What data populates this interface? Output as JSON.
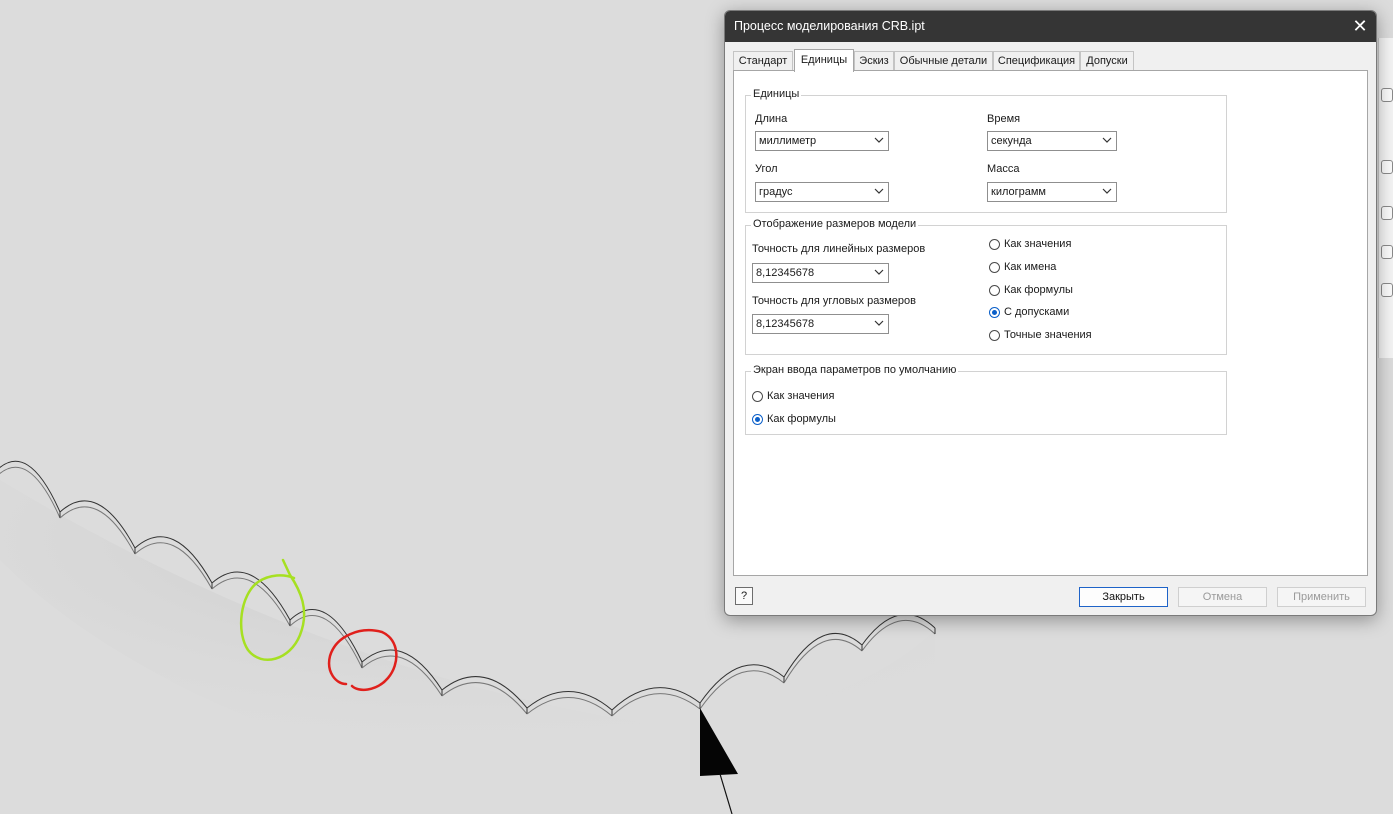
{
  "dialog": {
    "title": "Процесс моделирования CRB.ipt",
    "close_glyph": "✕",
    "tabs": [
      {
        "label": "Стандарт",
        "active": false
      },
      {
        "label": "Единицы",
        "active": true
      },
      {
        "label": "Эскиз",
        "active": false
      },
      {
        "label": "Обычные детали",
        "active": false
      },
      {
        "label": "Спецификация",
        "active": false
      },
      {
        "label": "Допуски",
        "active": false
      }
    ],
    "units": {
      "title": "Единицы",
      "length": {
        "label": "Длина",
        "value": "миллиметр"
      },
      "time": {
        "label": "Время",
        "value": "секунда"
      },
      "angle": {
        "label": "Угол",
        "value": "градус"
      },
      "mass": {
        "label": "Масса",
        "value": "килограмм"
      }
    },
    "dimension_display": {
      "title": "Отображение размеров модели",
      "linear_precision": {
        "label": "Точность для линейных размеров",
        "value": "8,12345678"
      },
      "angular_precision": {
        "label": "Точность для угловых размеров",
        "value": "8,12345678"
      },
      "options": [
        {
          "label": "Как значения",
          "selected": false
        },
        {
          "label": "Как имена",
          "selected": false
        },
        {
          "label": "Как формулы",
          "selected": false
        },
        {
          "label": "С допусками",
          "selected": true
        },
        {
          "label": "Точные значения",
          "selected": false
        }
      ]
    },
    "parameter_input": {
      "title": "Экран ввода параметров по умолчанию",
      "options": [
        {
          "label": "Как значения",
          "selected": false
        },
        {
          "label": "Как формулы",
          "selected": true
        }
      ]
    },
    "help_glyph": "?",
    "buttons": {
      "close": "Закрыть",
      "cancel": "Отмена",
      "apply": "Применить"
    }
  },
  "colors": {
    "accent": "#0a5fc9",
    "annotation_green": "#a6e022",
    "annotation_red": "#e0201c"
  }
}
